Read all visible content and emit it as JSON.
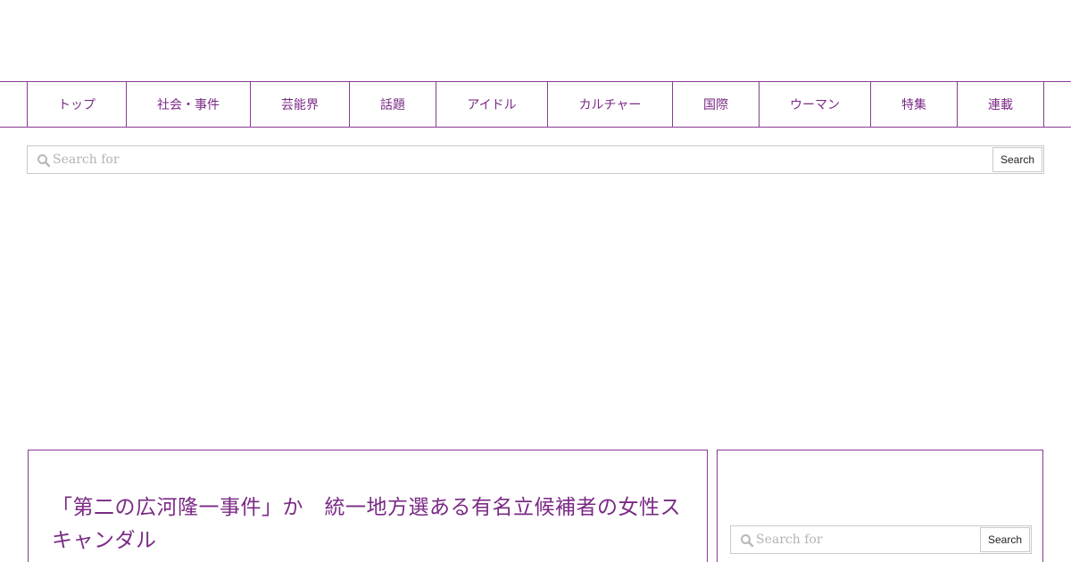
{
  "nav": {
    "items": [
      "トップ",
      "社会・事件",
      "芸能界",
      "話題",
      "アイドル",
      "カルチャー",
      "国際",
      "ウーマン",
      "特集",
      "連載"
    ]
  },
  "search": {
    "placeholder": "Search for",
    "button_label": "Search",
    "icon": "search-icon"
  },
  "article": {
    "title": "「第二の広河隆一事件」か　統一地方選ある有名立候補者の女性スキャンダル"
  },
  "sidebar": {
    "search_placeholder": "Search for",
    "search_button_label": "Search"
  },
  "colors": {
    "accent": "#7a2a85",
    "border": "#8a3a95",
    "input_border": "#c9c9c9"
  }
}
